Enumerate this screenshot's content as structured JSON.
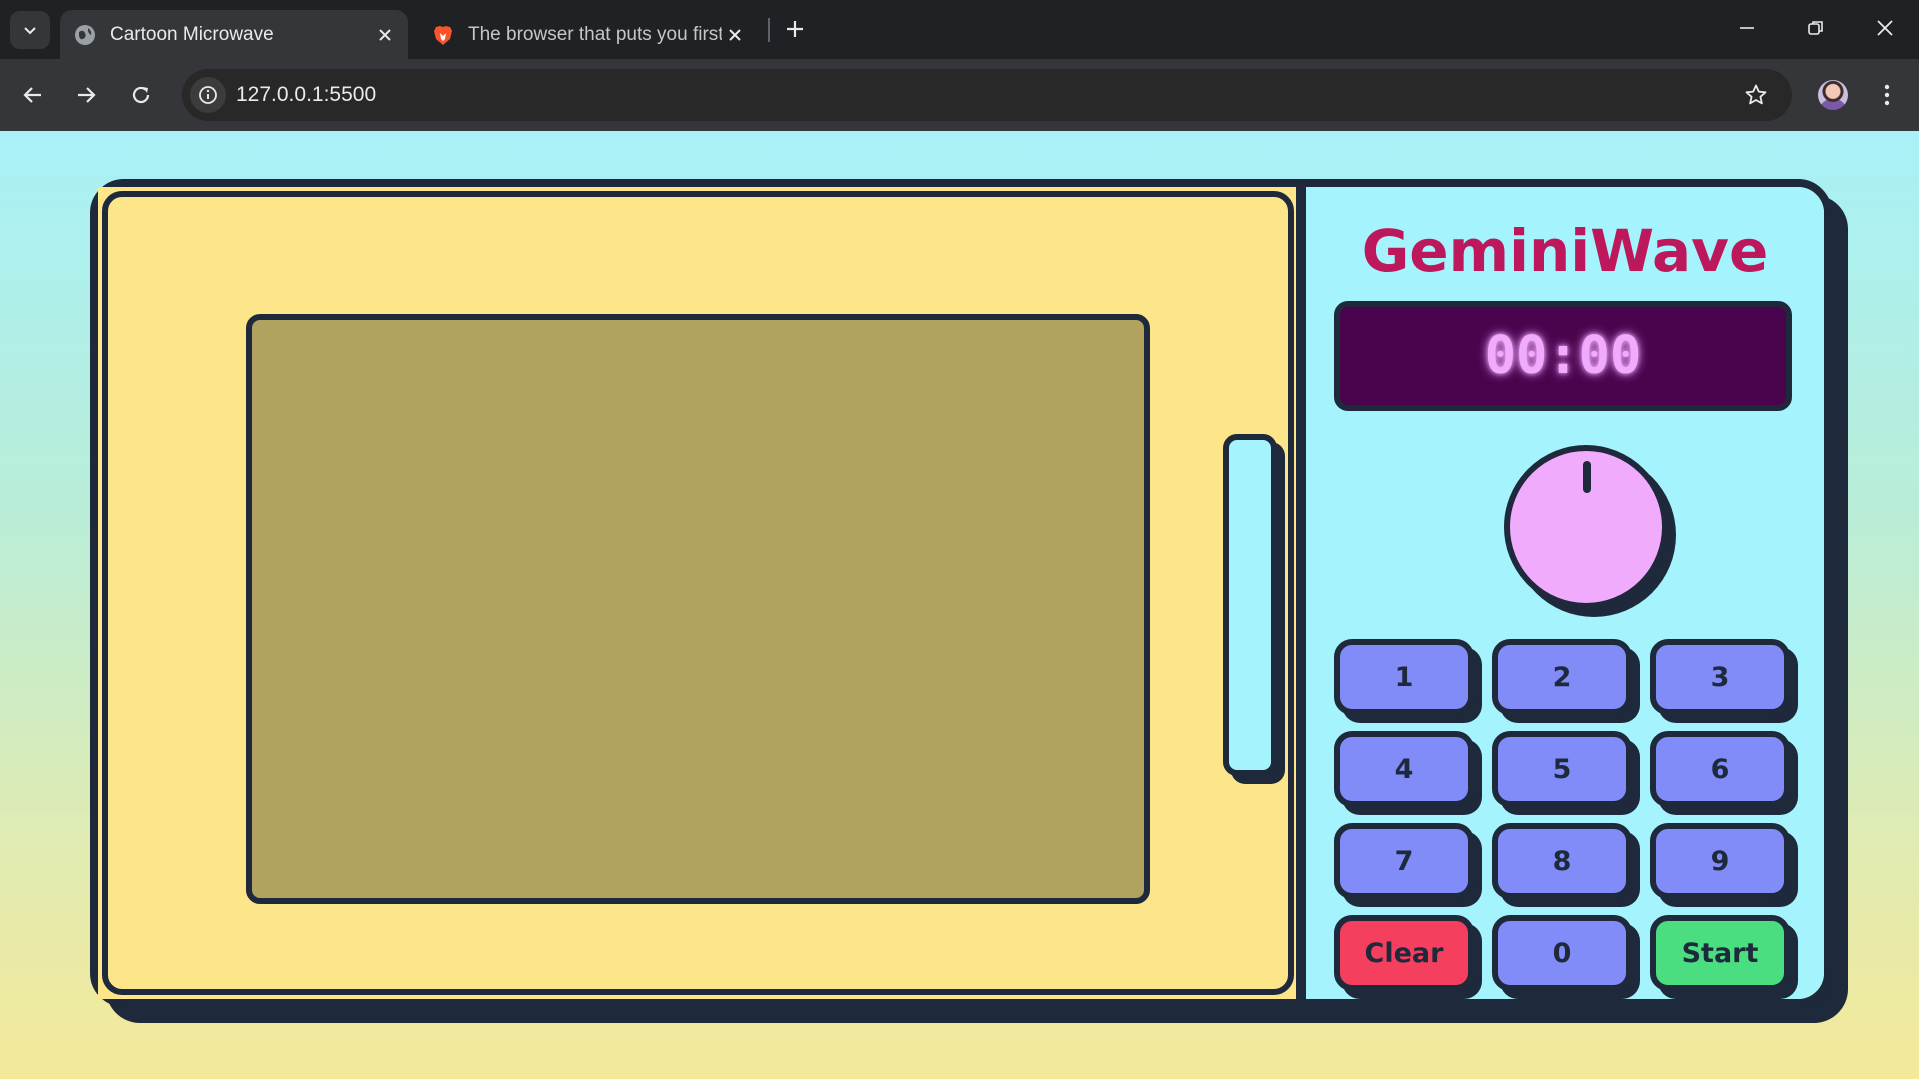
{
  "browser": {
    "tabs": [
      {
        "title": "Cartoon Microwave",
        "active": true,
        "icon": "globe-icon"
      },
      {
        "title": "The browser that puts you first",
        "active": false,
        "icon": "brave-lion-icon"
      }
    ],
    "url": "127.0.0.1:5500"
  },
  "microwave": {
    "brand": "GeminiWave",
    "timer": "00:00",
    "keys": [
      {
        "label": "1",
        "kind": "digit"
      },
      {
        "label": "2",
        "kind": "digit"
      },
      {
        "label": "3",
        "kind": "digit"
      },
      {
        "label": "4",
        "kind": "digit"
      },
      {
        "label": "5",
        "kind": "digit"
      },
      {
        "label": "6",
        "kind": "digit"
      },
      {
        "label": "7",
        "kind": "digit"
      },
      {
        "label": "8",
        "kind": "digit"
      },
      {
        "label": "9",
        "kind": "digit"
      },
      {
        "label": "Clear",
        "kind": "clear"
      },
      {
        "label": "0",
        "kind": "digit"
      },
      {
        "label": "Start",
        "kind": "start"
      }
    ]
  },
  "colors": {
    "body": "#fde68a",
    "outline": "#1e293b",
    "window": "#b2a25f",
    "panel": "#a5f3fc",
    "brand": "#be185d",
    "display_bg": "#4a044e",
    "display_text": "#f0abfc",
    "key": "#818cf8",
    "clear": "#f43f5e",
    "start": "#4ade80"
  }
}
